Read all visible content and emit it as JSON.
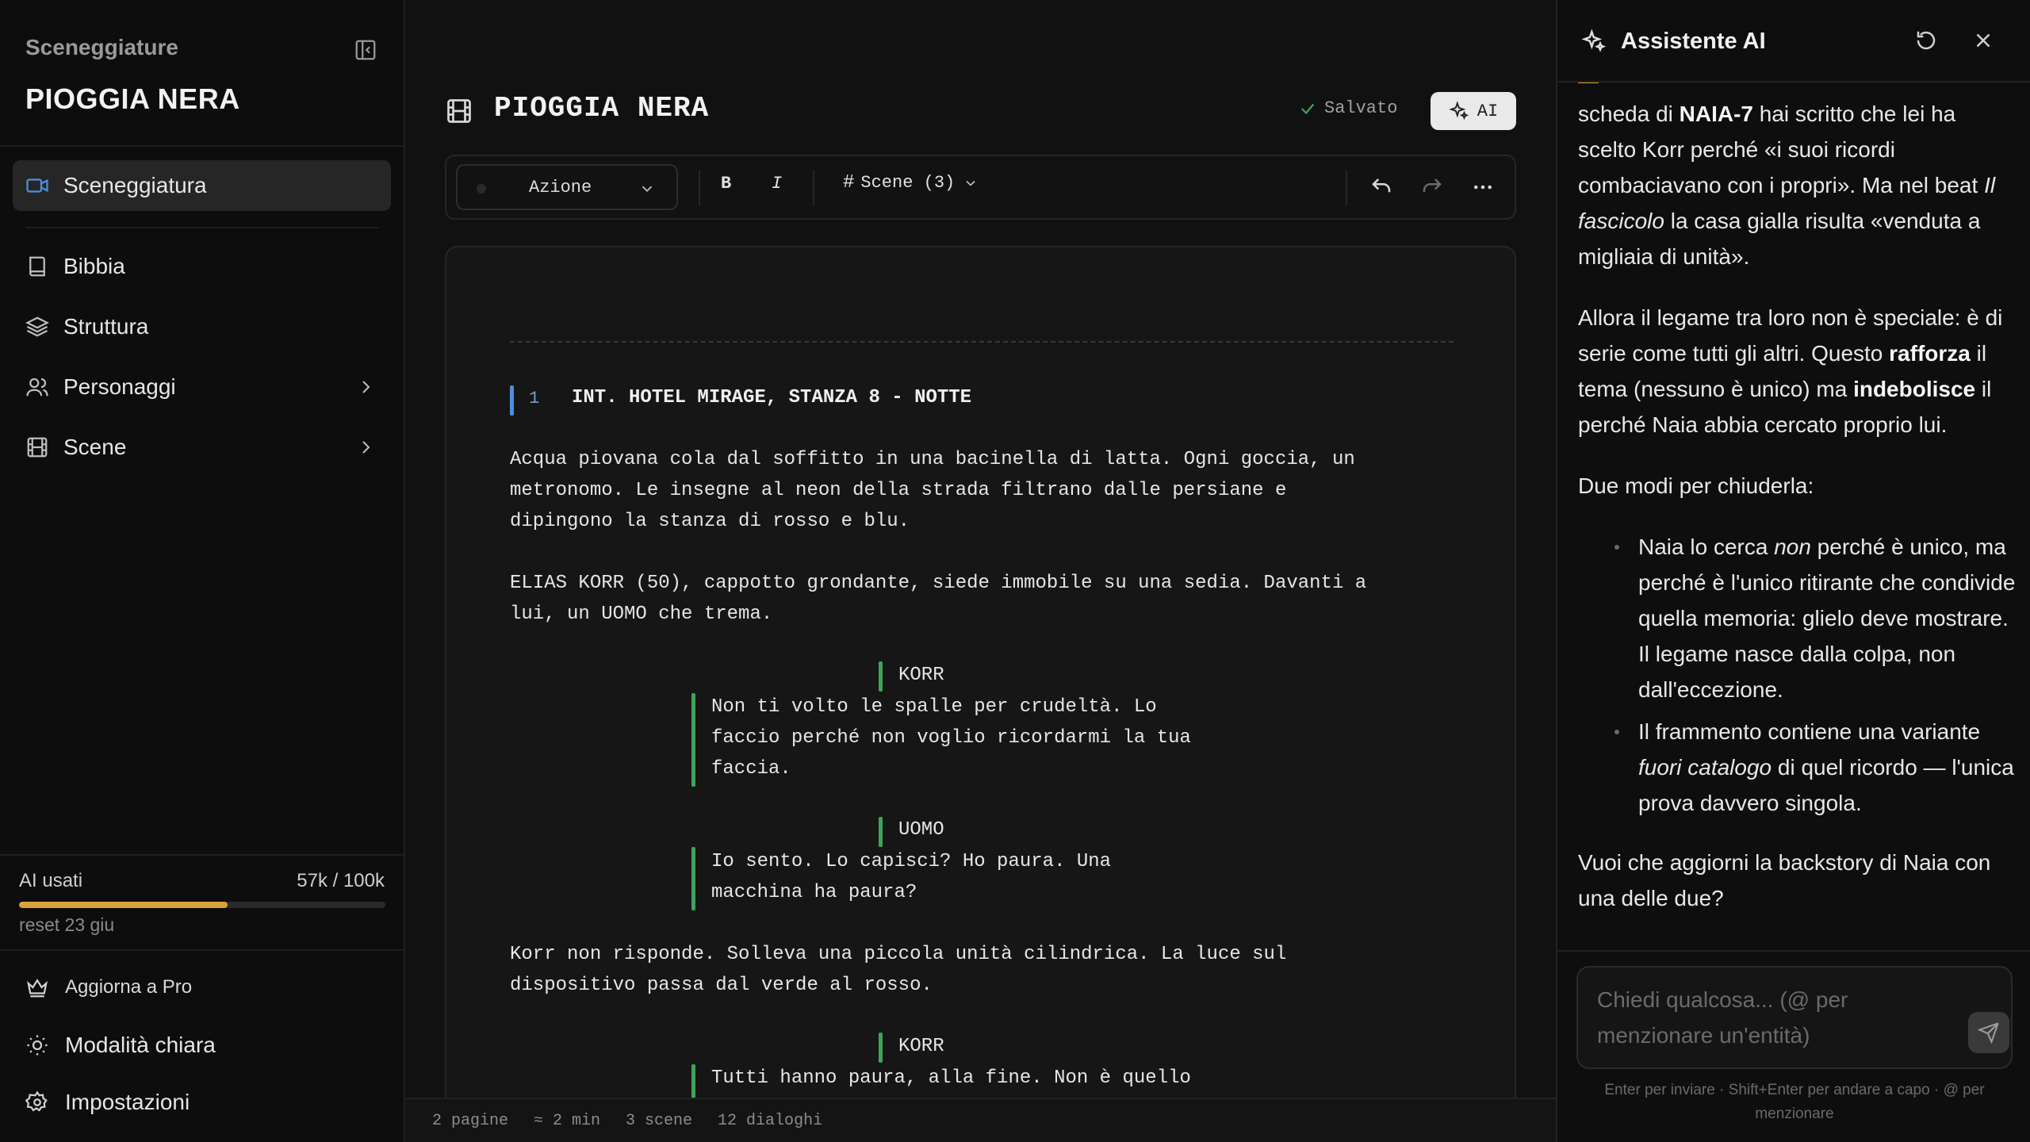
{
  "sidebar": {
    "project_label": "Sceneggiature",
    "project_title": "PIOGGIA NERA",
    "nav": {
      "sceneggiatura": "Sceneggiatura",
      "bibbia": "Bibbia",
      "struttura": "Struttura",
      "personaggi": "Personaggi",
      "scene": "Scene"
    },
    "usage": {
      "label": "AI usati",
      "value": "57k / 100k",
      "fraction": 0.57,
      "reset": "reset 23 giu"
    },
    "footer": {
      "upgrade": "Aggiorna a Pro",
      "theme": "Modalità chiara",
      "settings": "Impostazioni"
    }
  },
  "editor": {
    "title": "PIOGGIA NERA",
    "saved": "Salvato",
    "ai_button": "AI",
    "toolbar": {
      "element_type": "Azione",
      "bold": "B",
      "italic": "I",
      "scenes": "Scene (3)"
    },
    "scene": {
      "number": "1",
      "heading": "INT. HOTEL MIRAGE, STANZA 8 - NOTTE"
    },
    "script": {
      "action_1": "Acqua piovana cola dal soffitto in una bacinella di latta. Ogni goccia, un\nmetronomo. Le insegne al neon della strada filtrano dalle persiane e\ndipingono la stanza di rosso e blu.",
      "action_2": "ELIAS KORR (50), cappotto grondante, siede immobile su una sedia. Davanti a\nlui, un UOMO che trema.",
      "char_1": "KORR",
      "dialogue_1": "Non ti volto le spalle per crudeltà. Lo\nfaccio perché non voglio ricordarmi la tua\nfaccia.",
      "char_2": "UOMO",
      "dialogue_2": "Io sento. Lo capisci? Ho paura. Una\nmacchina ha paura?",
      "action_3": "Korr non risponde. Solleva una piccola unità cilindrica. La luce sul\ndispositivo passa dal verde al rosso.",
      "char_3": "KORR",
      "dialogue_3": "Tutti hanno paura, alla fine. Non è quello"
    },
    "status": {
      "pages": "2 pagine",
      "duration": "≈ 2 min",
      "scenes": "3 scene",
      "dialogues": "12 dialoghi"
    }
  },
  "assistant": {
    "title": "Assistente AI",
    "message": {
      "p1_a": "scheda di ",
      "p1_b": "NAIA-7",
      "p1_c": " hai scritto che lei ha scelto Korr perché «i suoi ricordi combaciavano con i propri». Ma nel beat ",
      "p1_d": "Il fascicolo",
      "p1_e": " la casa gialla risulta «venduta a migliaia di unità».",
      "p2_a": "Allora il legame tra loro non è speciale: è di serie come tutti gli altri. Questo ",
      "p2_b": "rafforza",
      "p2_c": " il tema (nessuno è unico) ma ",
      "p2_d": "indebolisce",
      "p2_e": " il perché Naia abbia cercato proprio lui.",
      "p3": "Due modi per chiuderla:",
      "li1_a": "Naia lo cerca ",
      "li1_b": "non",
      "li1_c": " perché è unico, ma perché è l'unico ritirante che condivide quella memoria: glielo deve mostrare. Il legame nasce dalla colpa, non dall'eccezione.",
      "li2_a": "Il frammento contiene una variante ",
      "li2_b": "fuori catalogo",
      "li2_c": " di quel ricordo — l'unica prova davvero singola.",
      "p4": "Vuoi che aggiorni la backstory di Naia con una delle due?"
    },
    "input_placeholder": "Chiedi qualcosa... (@ per menzionare un'entità)",
    "hint": "Enter per inviare · Shift+Enter per andare a capo · @ per menzionare"
  },
  "colors": {
    "accent_blue": "#4b8fe0",
    "dialogue_green": "#3fa45b",
    "usage_orange": "#d9a23a"
  }
}
